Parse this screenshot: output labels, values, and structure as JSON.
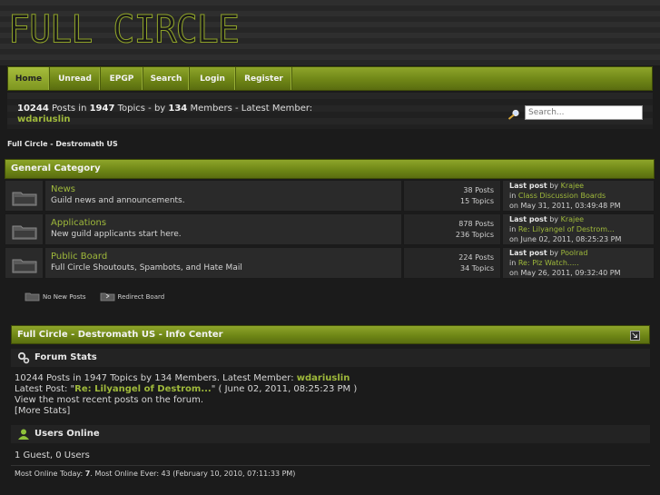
{
  "site": {
    "logo_text": "FULL CIRCLE"
  },
  "nav": {
    "items": [
      {
        "label": "Home",
        "active": true
      },
      {
        "label": "Unread"
      },
      {
        "label": "EPGP"
      },
      {
        "label": "Search"
      },
      {
        "label": "Login"
      },
      {
        "label": "Register"
      }
    ]
  },
  "stats": {
    "posts": "10244",
    "posts_label": " Posts in ",
    "topics": "1947",
    "topics_label": " Topics - by ",
    "members": "134",
    "members_label": " Members - Latest Member:",
    "latest_member": "wdariuslin"
  },
  "search": {
    "placeholder": "Search..."
  },
  "breadcrumb": "Full Circle - Destromath US",
  "category": {
    "title": "General Category"
  },
  "boards": [
    {
      "name": "News",
      "description": "Guild news and announcements.",
      "posts": "38 Posts",
      "topics": "15 Topics",
      "last_post_label": "Last post",
      "by": " by ",
      "author": "Krajee",
      "in": "in ",
      "topic": "Class Discussion Boards",
      "on": "on May 31, 2011, 03:49:48 PM"
    },
    {
      "name": "Applications",
      "description": "New guild applicants start here.",
      "posts": "878 Posts",
      "topics": "236 Topics",
      "last_post_label": "Last post",
      "by": " by ",
      "author": "Krajee",
      "in": "in ",
      "topic": "Re: Lilyangel of Destrom...",
      "on": "on June 02, 2011, 08:25:23 PM"
    },
    {
      "name": "Public Board",
      "description": "Full Circle Shoutouts, Spambots, and Hate Mail",
      "posts": "224 Posts",
      "topics": "34 Topics",
      "last_post_label": "Last post",
      "by": " by ",
      "author": "Poolrad",
      "in": "in ",
      "topic": "Re: Plz Watch.....",
      "on": "on May 26, 2011, 09:32:40 PM"
    }
  ],
  "legend": {
    "no_new": "No New Posts",
    "redirect": "Redirect Board"
  },
  "info_center": {
    "title": "Full Circle - Destromath US - Info Center",
    "forum_stats_label": "Forum Stats",
    "stats_line_prefix": "10244 Posts in 1947 Topics by 134 Members. Latest Member: ",
    "stats_line_member": "wdariuslin",
    "latest_post_prefix": "Latest Post: \"",
    "latest_post_title": "Re: Lilyangel of Destrom...",
    "latest_post_suffix": "\" ( June 02, 2011, 08:25:23 PM )",
    "recent_link": "View the most recent posts on the forum.",
    "more_stats": "[More Stats]",
    "users_online_label": "Users Online",
    "guests_line": "1 Guest, 0 Users",
    "most_online_prefix": "Most Online Today: ",
    "most_online_today": "7",
    "most_online_suffix": ". Most Online Ever: 43 (February 10, 2010, 07:11:33 PM)"
  },
  "colors": {
    "accent": "#9fb93b",
    "nav_green": "#6f8617",
    "background": "#1b1b1b"
  }
}
